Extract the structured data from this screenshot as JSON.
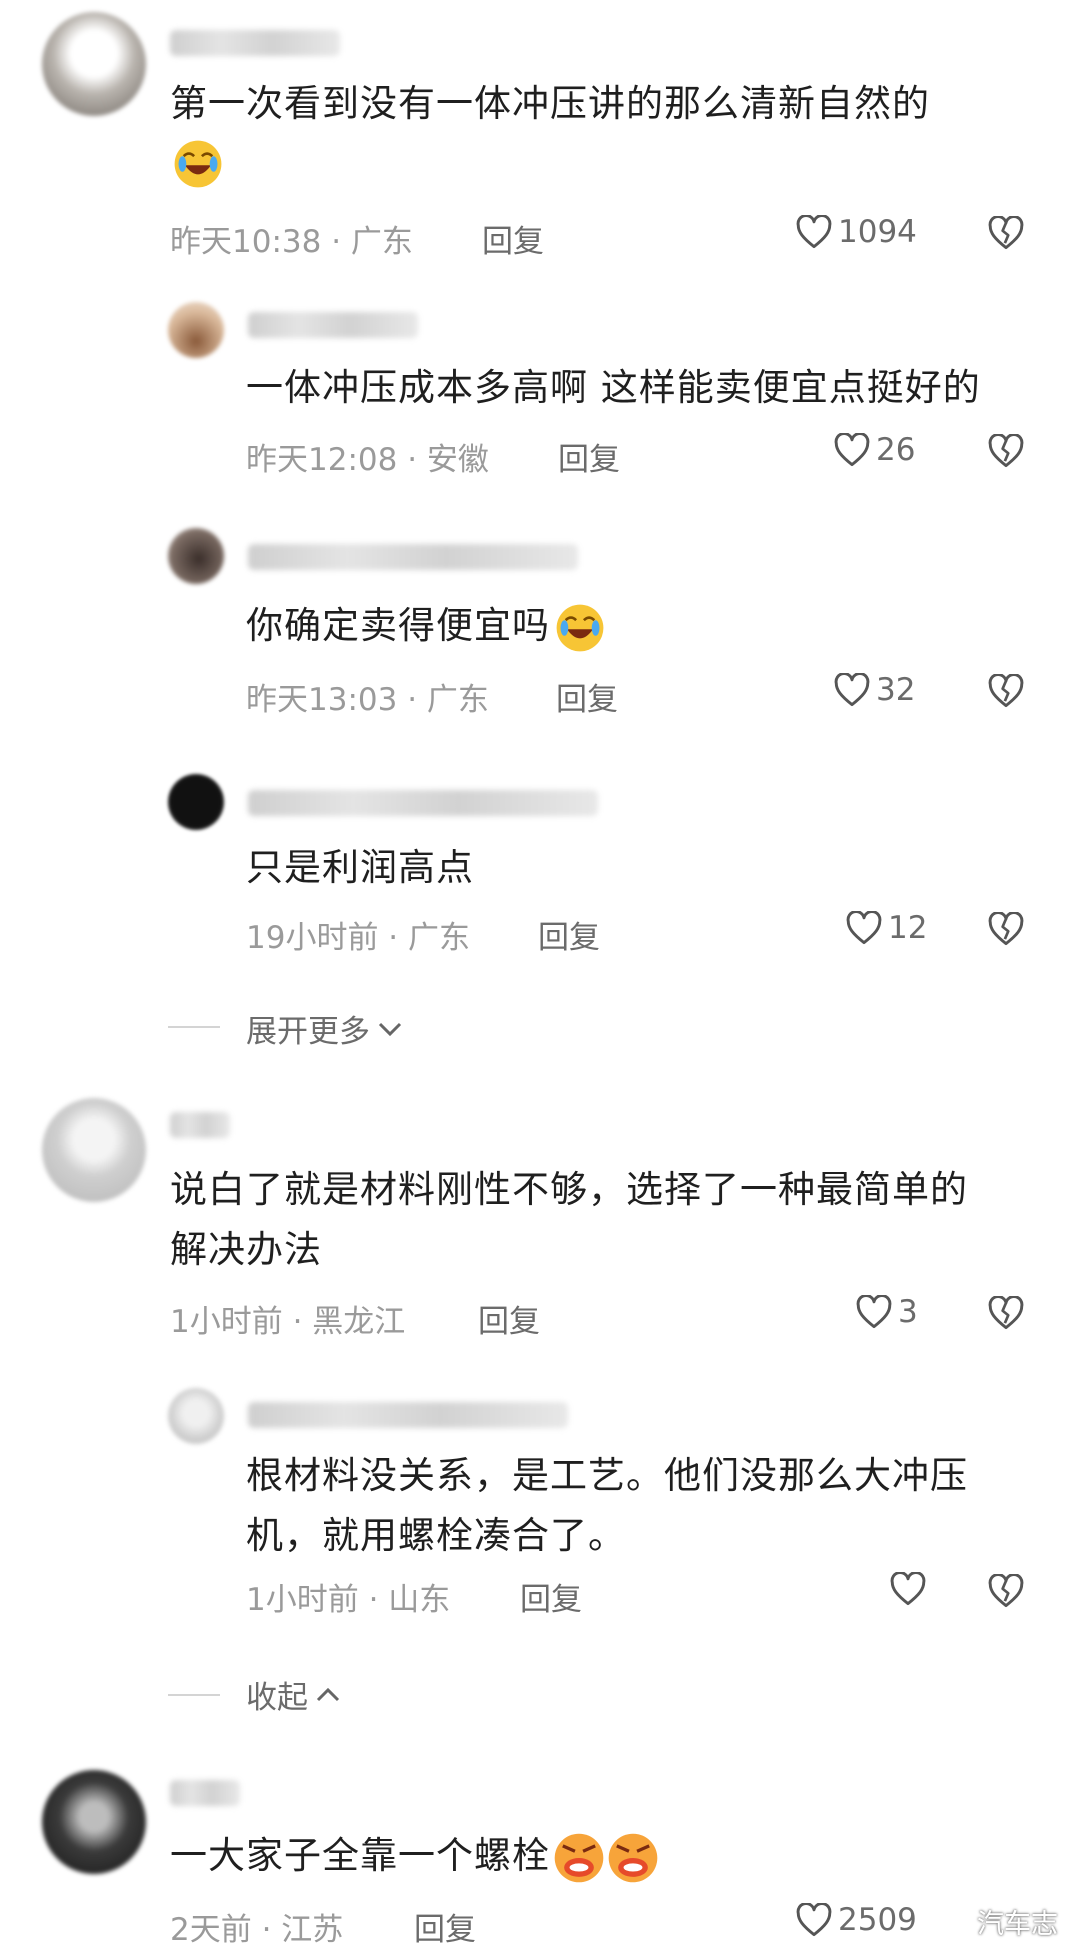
{
  "comments": [
    {
      "text": "第一次看到没有一体冲压讲的那么清新自然的",
      "time": "昨天10:38 · 广东",
      "reply": "回复",
      "likes": "1094"
    },
    {
      "text": "一体冲压成本多高啊 这样能卖便宜点挺好的",
      "time": "昨天12:08 · 安徽",
      "reply": "回复",
      "likes": "26"
    },
    {
      "text": "你确定卖得便宜吗",
      "time": "昨天13:03 · 广东",
      "reply": "回复",
      "likes": "32"
    },
    {
      "text": "只是利润高点",
      "time": "19小时前 · 广东",
      "reply": "回复",
      "likes": "12"
    },
    {
      "text1": "说白了就是材料刚性不够，选择了一种最简单的",
      "text2": "解决办法",
      "time": "1小时前 · 黑龙江",
      "reply": "回复",
      "likes": "3"
    },
    {
      "text1": "根材料没关系，是工艺。他们没那么大冲压",
      "text2": "机，就用螺栓凑合了。",
      "time": "1小时前 · 山东",
      "reply": "回复",
      "likes": ""
    },
    {
      "text": "一大家子全靠一个螺栓",
      "time": "2天前 · 江苏",
      "reply": "回复",
      "likes": "2509"
    }
  ],
  "expand_more": "展开更多",
  "collapse": "收起",
  "watermark": "汽车志",
  "icons": {
    "like": "heart-outline-icon",
    "dislike": "broken-heart-icon",
    "emoji_laugh": "laugh-tears-emoji",
    "emoji_angry": "angry-face-emoji"
  }
}
